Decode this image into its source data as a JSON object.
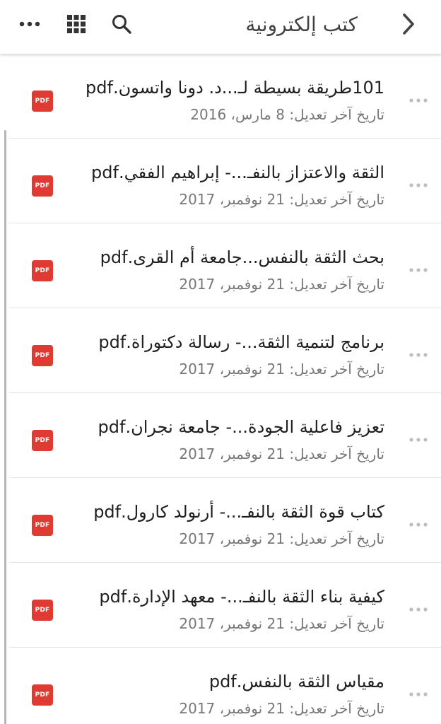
{
  "header": {
    "title": "كتب إلكترونية",
    "back_icon": "chevron-right-icon",
    "search_icon": "search-icon",
    "grid_icon": "grid-view-icon",
    "more_icon": "more-horizontal-icon"
  },
  "colors": {
    "pdf_badge": "#e03b32",
    "title_text": "#424242",
    "secondary_text": "#777777"
  },
  "files": [
    {
      "badge": "PDF",
      "name": "101طريقة بسيطة لـ...د. دونا واتسون.pdf",
      "date": "تاريخ آخر تعديل: 8 مارس، 2016"
    },
    {
      "badge": "PDF",
      "name": "الثقة والاعتزاز بالنفـ...- إبراهيم الفقي.pdf",
      "date": "تاريخ آخر تعديل: 21 نوفمبر، 2017"
    },
    {
      "badge": "PDF",
      "name": "بحث الثقة بالنفس...جامعة أم القرى.pdf",
      "date": "تاريخ آخر تعديل: 21 نوفمبر، 2017"
    },
    {
      "badge": "PDF",
      "name": "برنامج لتنمية الثقة...- رسالة دكتوراة.pdf",
      "date": "تاريخ آخر تعديل: 21 نوفمبر، 2017"
    },
    {
      "badge": "PDF",
      "name": "تعزيز فاعلية الجودة...- جامعة نجران.pdf",
      "date": "تاريخ آخر تعديل: 21 نوفمبر، 2017"
    },
    {
      "badge": "PDF",
      "name": "كتاب قوة الثقة بالنفـ...- أرنولد كارول.pdf",
      "date": "تاريخ آخر تعديل: 21 نوفمبر، 2017"
    },
    {
      "badge": "PDF",
      "name": "كيفية بناء الثقة بالنفـ...- معهد الإدارة.pdf",
      "date": "تاريخ آخر تعديل: 21 نوفمبر، 2017"
    },
    {
      "badge": "PDF",
      "name": "مقياس الثقة بالنفس.pdf",
      "date": "تاريخ آخر تعديل: 21 نوفمبر، 2017"
    }
  ]
}
